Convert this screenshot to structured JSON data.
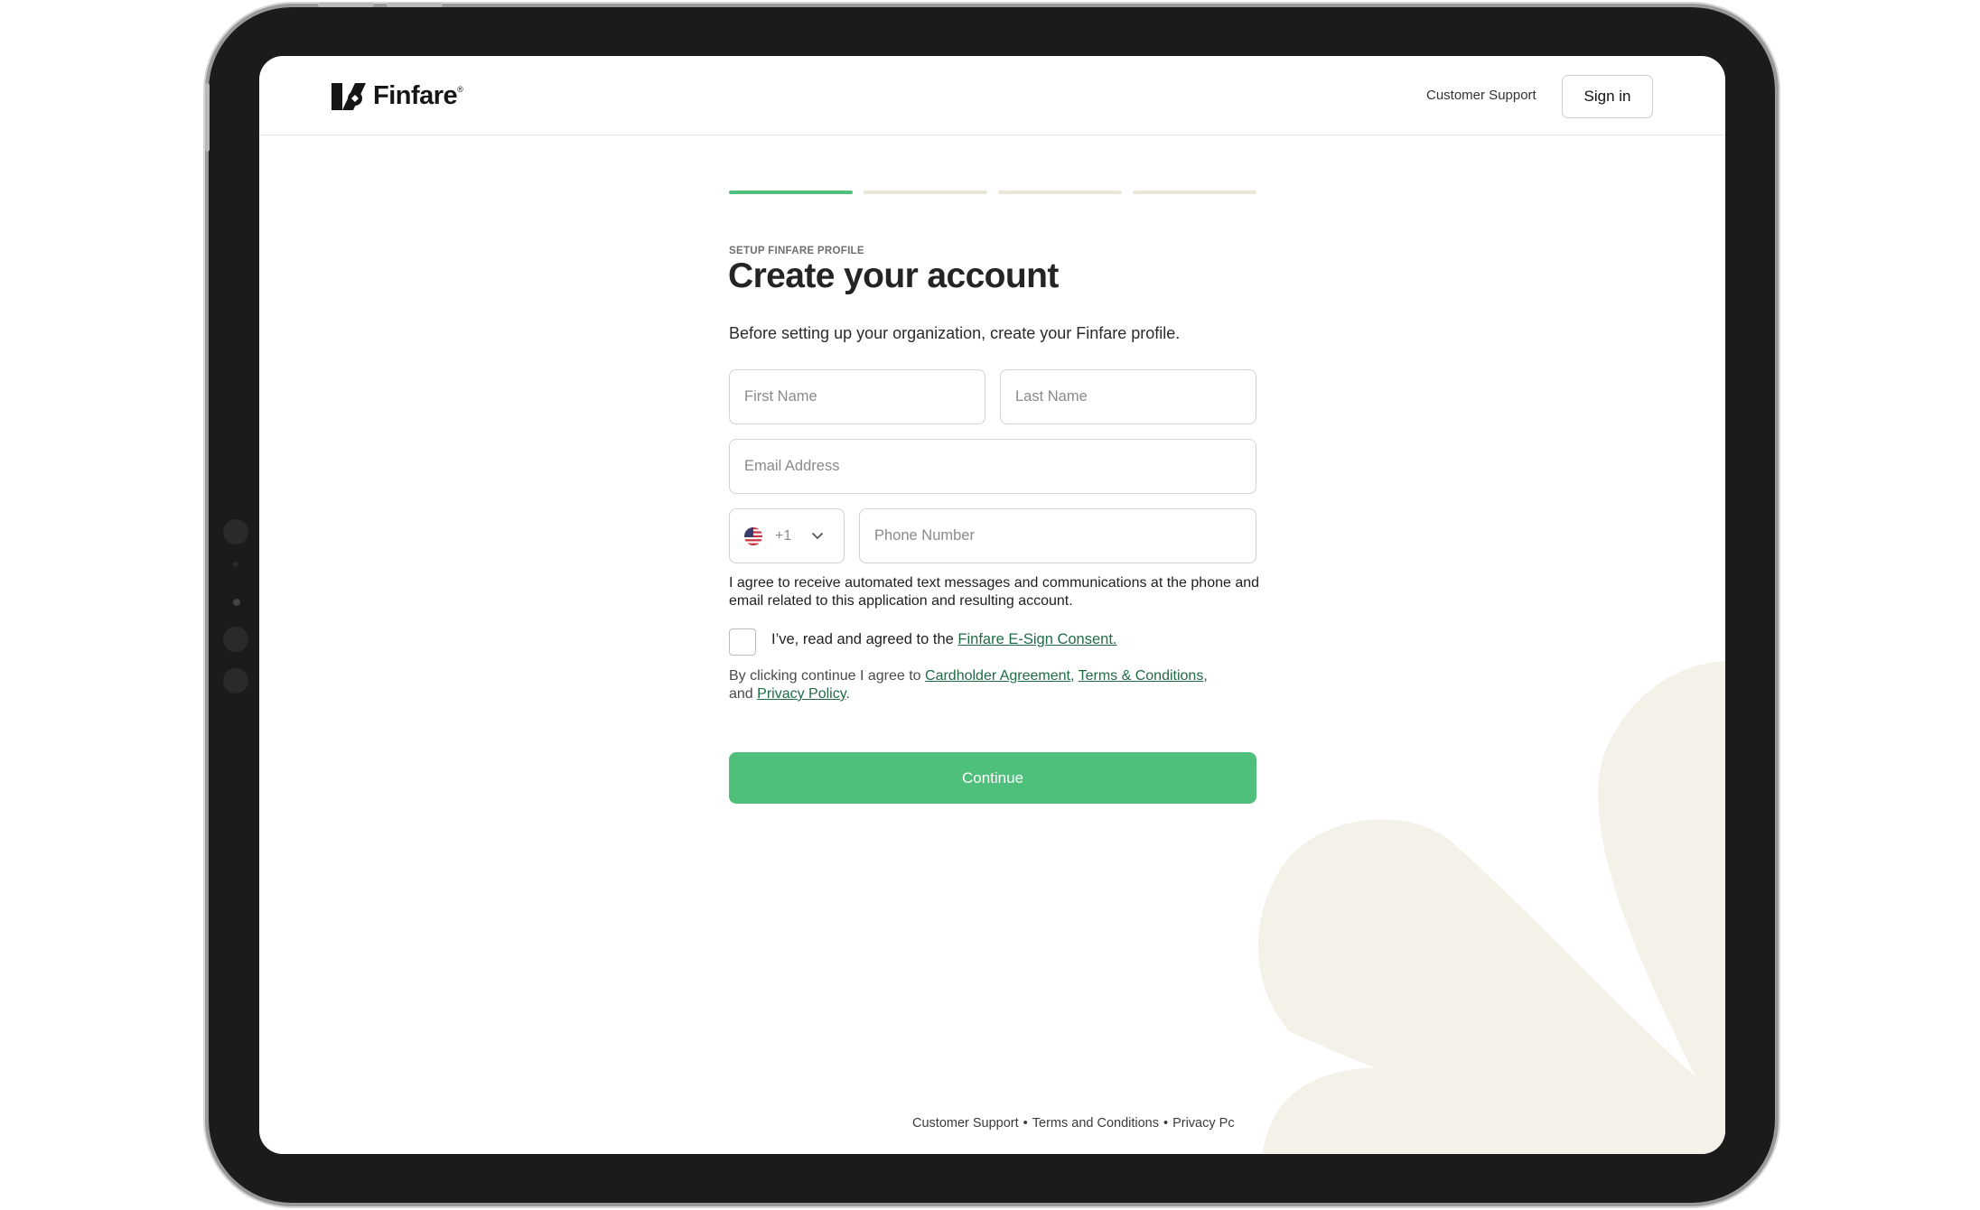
{
  "brand": {
    "name": "Finfare",
    "trademark": "®"
  },
  "header": {
    "support_label": "Customer Support",
    "signin_label": "Sign in"
  },
  "progress": {
    "total_steps": 4,
    "current_step": 1,
    "active_color": "#4fbf7c",
    "inactive_color": "#ebe6da"
  },
  "form": {
    "eyebrow": "SETUP FINFARE PROFILE",
    "title": "Create your account",
    "subtitle": "Before setting up your organization, create your Finfare profile.",
    "first_name_placeholder": "First Name",
    "last_name_placeholder": "Last Name",
    "email_placeholder": "Email Address",
    "country_flag": "us-flag-icon",
    "country_code": "+1",
    "phone_placeholder": "Phone Number",
    "consent_text": "I agree to receive automated text messages and communications at the phone and email related to this application and resulting account.",
    "esign": {
      "prefix": "I’ve, read and agreed to the ",
      "link": "Finfare E-Sign Consent.",
      "checked": false
    },
    "legal": {
      "prefix": "By clicking continue I agree to ",
      "cardholder": "Cardholder Agreement,",
      "terms": "Terms & Conditions",
      "comma": ",",
      "and": "and ",
      "privacy": "Privacy Policy",
      "period": "."
    },
    "continue_label": "Continue",
    "accent_color": "#4fbf7c"
  },
  "footer": {
    "support": "Customer Support",
    "sep": "•",
    "terms": "Terms and Conditions",
    "privacy": "Privacy Pc"
  }
}
